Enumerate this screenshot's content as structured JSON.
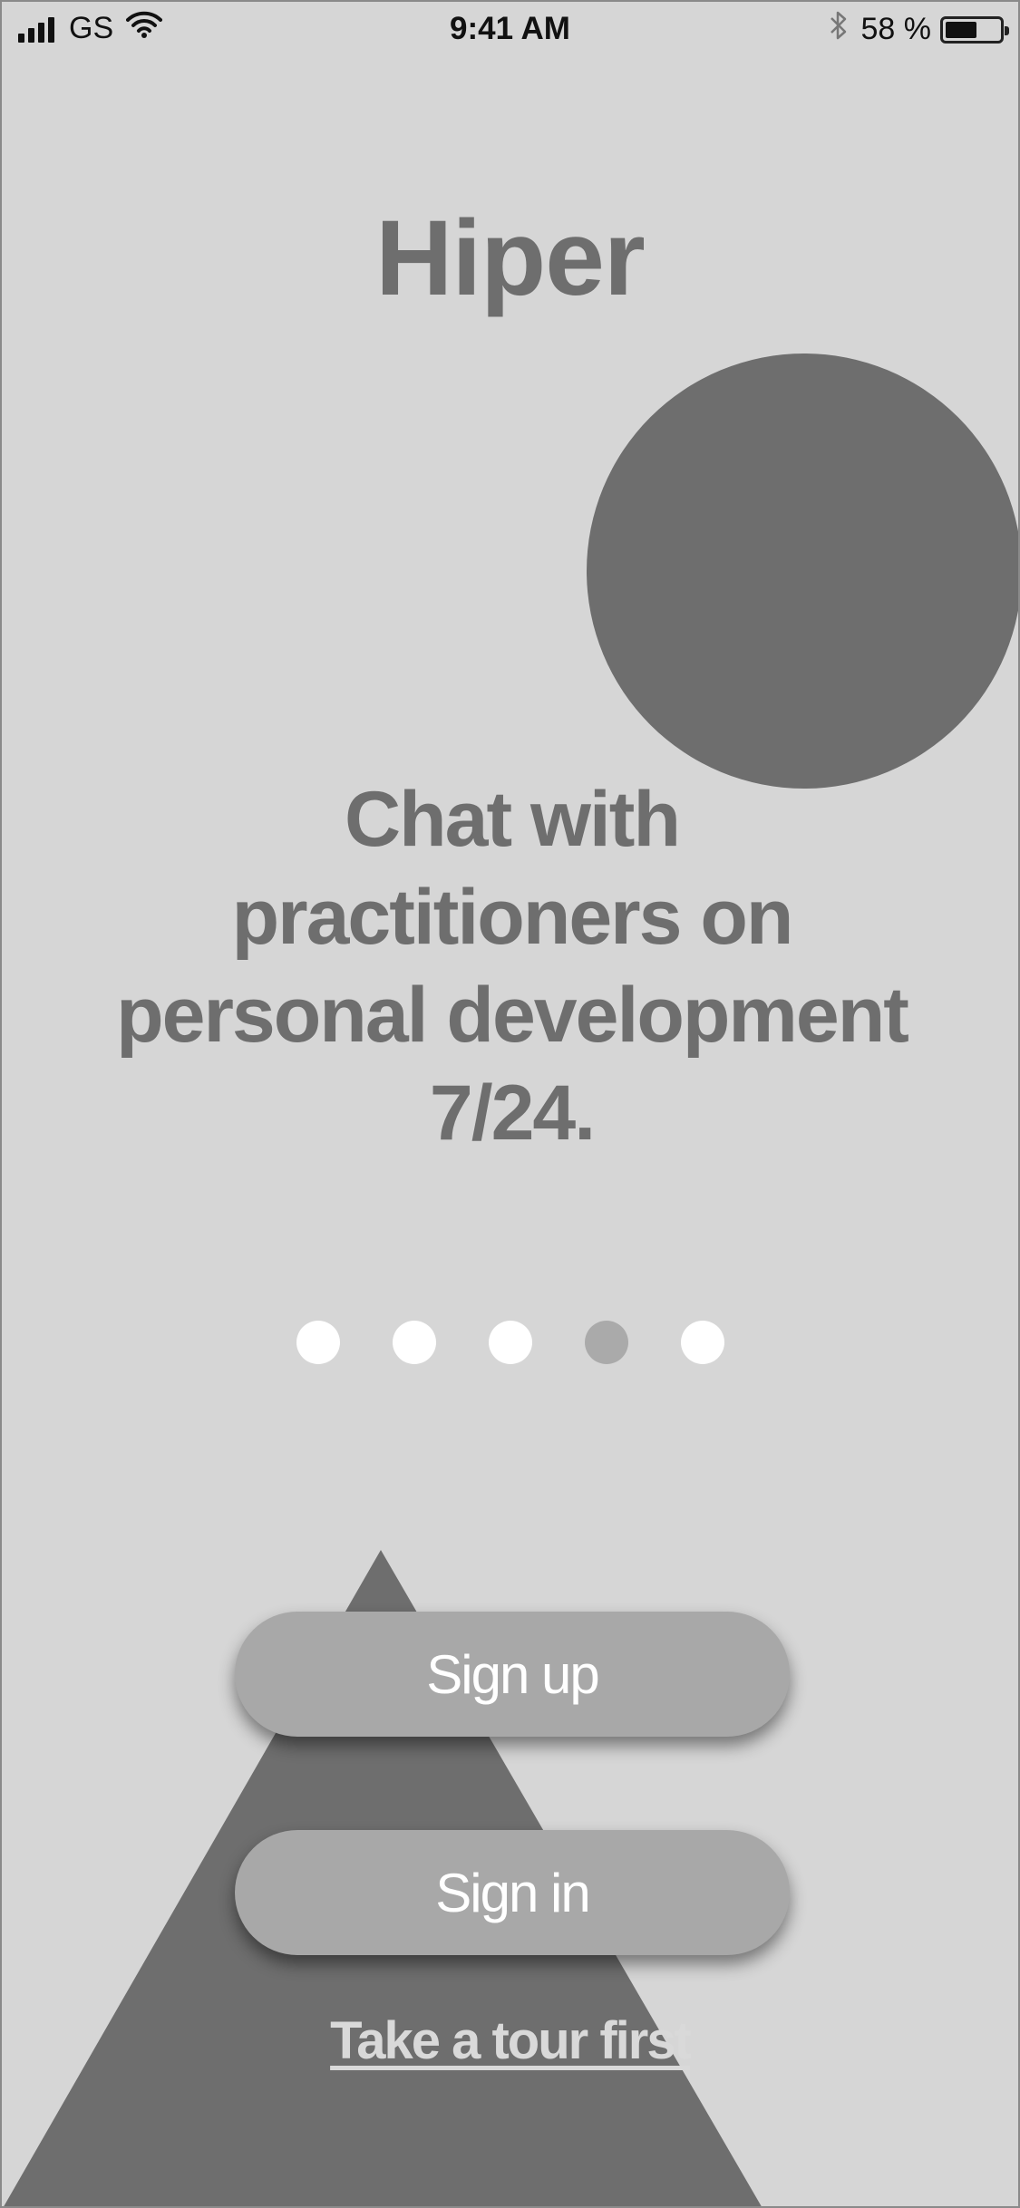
{
  "status_bar": {
    "carrier": "GS",
    "time": "9:41 AM",
    "battery_percent": "58 %",
    "battery_level": 0.58,
    "icons": [
      "signal-icon",
      "wifi-icon",
      "bluetooth-icon",
      "battery-icon"
    ]
  },
  "app": {
    "logo": "Hiper"
  },
  "onboarding": {
    "headline_lines": [
      "Chat with",
      "practitioners on",
      "personal development",
      "7/24."
    ],
    "page_count": 5,
    "active_page": 4
  },
  "actions": {
    "signup_label": "Sign up",
    "signin_label": "Sign in",
    "tour_label": "Take a tour first"
  },
  "colors": {
    "background": "#d6d6d6",
    "shape": "#6e6e6e",
    "button": "#a8a8a8",
    "dot": "#ffffff",
    "dot_active": "#aaaaaa"
  }
}
